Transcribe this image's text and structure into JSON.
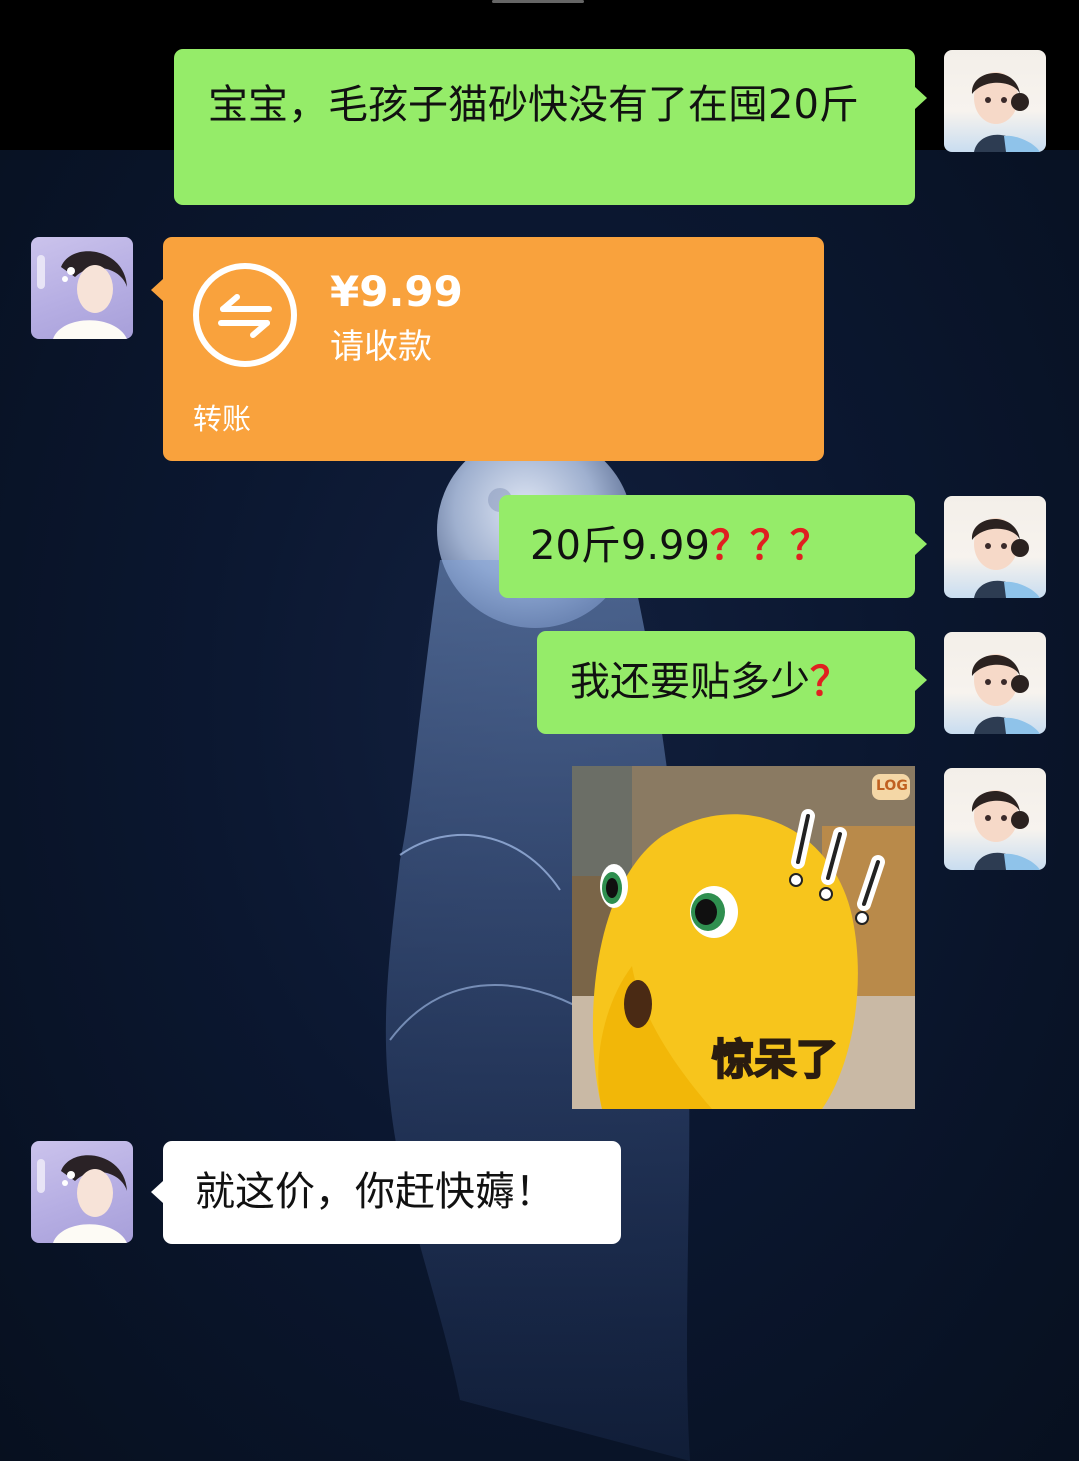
{
  "messages": [
    {
      "side": "right",
      "type": "text",
      "text": "宝宝，毛孩子猫砂快没有了在囤20斤"
    },
    {
      "side": "left",
      "type": "transfer",
      "amount": "¥9.99",
      "status": "请收款",
      "label": "转账"
    },
    {
      "side": "right",
      "type": "text",
      "text": "20斤9.99",
      "marks": "？？？"
    },
    {
      "side": "right",
      "type": "text",
      "text": "我还要贴多少",
      "marks": "？"
    },
    {
      "side": "right",
      "type": "sticker",
      "caption": "惊呆了",
      "badge": "LOG"
    },
    {
      "side": "left",
      "type": "text",
      "text": "就这价，你赶快薅！"
    }
  ],
  "colors": {
    "sent_bubble": "#95ec69",
    "received_bubble": "#ffffff",
    "transfer_card": "#f9a23d",
    "question_mark": "#e02020"
  },
  "icons": {
    "transfer": "transfer-arrows-icon"
  }
}
